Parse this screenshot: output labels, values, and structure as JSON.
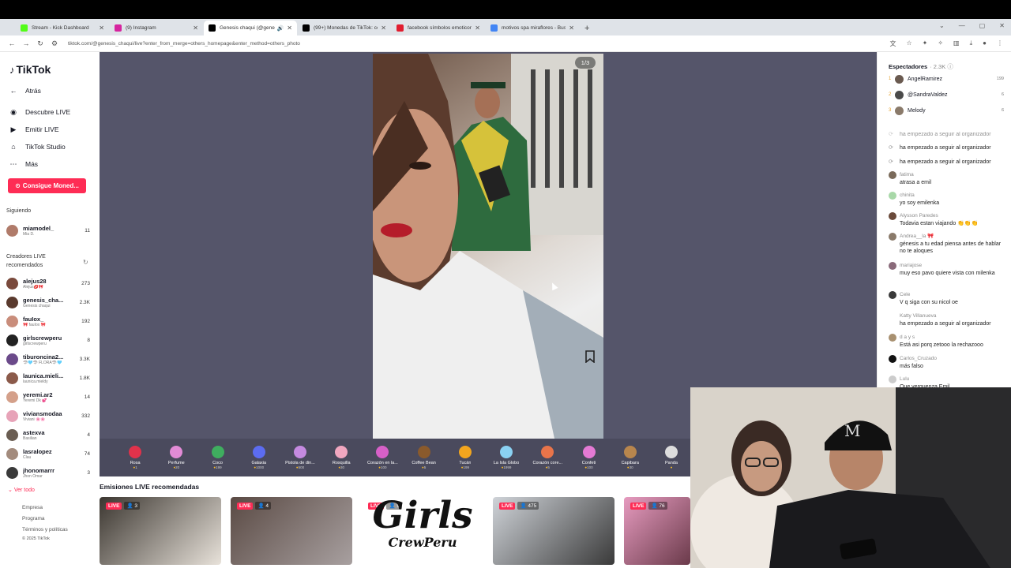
{
  "browser": {
    "tabs": [
      {
        "title": "Stream - Kick Dashboard",
        "color": "#53fc18",
        "active": false
      },
      {
        "title": "(9) Instagram",
        "color": "#d6249f",
        "active": false
      },
      {
        "title": "Genesis chaqui (@genesis_c",
        "color": "#000000",
        "active": true
      },
      {
        "title": "(99+) Monedas de TikTok: comp",
        "color": "#000000",
        "active": false
      },
      {
        "title": "facebook símbolos emoticono",
        "color": "#e11d2f",
        "active": false
      },
      {
        "title": "motivos spa miraflores - Buscar",
        "color": "#4285f4",
        "active": false
      }
    ],
    "url": "tiktok.com/@genesis_chaqui/live?enter_from_merge=others_homepage&enter_method=others_photo"
  },
  "sidebar": {
    "logo": "TikTok",
    "nav": [
      {
        "label": "Atrás",
        "icon": "back-arrow-icon"
      },
      {
        "label": "Descubre LIVE",
        "icon": "live-discover-icon"
      },
      {
        "label": "Emitir LIVE",
        "icon": "broadcast-icon"
      },
      {
        "label": "TikTok Studio",
        "icon": "studio-icon"
      },
      {
        "label": "Más",
        "icon": "more-icon"
      }
    ],
    "coins_button": "Consigue Moned...",
    "following_title": "Siguiendo",
    "following": [
      {
        "name": "miamodel_",
        "sub": "Mia D.",
        "count": "11",
        "color": "#b07b6a"
      }
    ],
    "recommended_title_1": "Creadores LIVE",
    "recommended_title_2": "recomendados",
    "recommended": [
      {
        "name": "alejus28",
        "sub": "Alejus💋🎀",
        "count": "273",
        "color": "#7a4a3c"
      },
      {
        "name": "genesis_cha...",
        "sub": "Genesis chaqui",
        "count": "2.3K",
        "color": "#5a3a2e"
      },
      {
        "name": "fauIox_",
        "sub": "🎀 fauIox 🎀",
        "count": "192",
        "color": "#c98d7b"
      },
      {
        "name": "girlscrewperu",
        "sub": "girlscrewperu",
        "count": "8",
        "color": "#222222"
      },
      {
        "name": "tiburoncina2...",
        "sub": "🦈🩵🦈 FLORA🦈🩵",
        "count": "3.3K",
        "color": "#6b4a8a"
      },
      {
        "name": "launica.mieli...",
        "sub": "launica.mieldy",
        "count": "1.8K",
        "color": "#8b5a4a"
      },
      {
        "name": "yeremi.ar2",
        "sub": "Yeremi Dk 💕",
        "count": "14",
        "color": "#d4a08a"
      },
      {
        "name": "viviansmodaa",
        "sub": "Viviani 🌸🌸",
        "count": "332",
        "color": "#e7a3b8"
      },
      {
        "name": "astexva",
        "sub": "Basilian",
        "count": "4",
        "color": "#6a5d52"
      },
      {
        "name": "lasralopez",
        "sub": "Clau",
        "count": "74",
        "color": "#a38b7d"
      },
      {
        "name": "jhonomarrr",
        "sub": "Jhon Omar",
        "count": "3",
        "color": "#3a3a3a"
      }
    ],
    "see_all": "Ver todo",
    "footer": [
      "Empresa",
      "Programa",
      "Términos y políticas",
      "© 2025 TikTok"
    ]
  },
  "video": {
    "counter": "1/3"
  },
  "gifts": [
    {
      "name": "Rosa",
      "price": "1",
      "color": "#e0324b"
    },
    {
      "name": "Perfume",
      "price": "20",
      "color": "#e28bd6"
    },
    {
      "name": "Coco",
      "price": "199",
      "color": "#3fae5f"
    },
    {
      "name": "Galaxia",
      "price": "1000",
      "color": "#5c6cf0"
    },
    {
      "name": "Pistola de din...",
      "price": "500",
      "color": "#c58ae0"
    },
    {
      "name": "Rosquilla",
      "price": "30",
      "color": "#f1a7c0"
    },
    {
      "name": "Corazón en la...",
      "price": "100",
      "color": "#d760c8"
    },
    {
      "name": "Coffee Bean",
      "price": "5",
      "color": "#8a5a2c"
    },
    {
      "name": "Tucán",
      "price": "199",
      "color": "#f2a51e"
    },
    {
      "name": "La Isla Globo",
      "price": "1999",
      "color": "#8ad1f2"
    },
    {
      "name": "Corazón core...",
      "price": "5",
      "color": "#e8744a"
    },
    {
      "name": "Confeti",
      "price": "100",
      "color": "#e47ad4"
    },
    {
      "name": "Capibara",
      "price": "30",
      "color": "#b8864d"
    },
    {
      "name": "Panda",
      "price": "",
      "color": "#dddddd"
    }
  ],
  "recommended_live": {
    "title": "Emisiones LIVE recomendadas",
    "live_label": "LIVE",
    "items": [
      {
        "viewers": "3",
        "colors": [
          "#3b3630",
          "#e8e2da"
        ]
      },
      {
        "viewers": "4",
        "colors": [
          "#5a4a44",
          "#a8a0a0"
        ]
      },
      {
        "viewers": "9",
        "colors": [
          "#ffffff",
          "#ffffff"
        ]
      },
      {
        "viewers": "475",
        "colors": [
          "#cfd3d8",
          "#3a3a3a"
        ]
      },
      {
        "viewers": "76",
        "colors": [
          "#e69bbf",
          "#6a3a4a"
        ]
      }
    ],
    "girls_line1": "Girls",
    "girls_line2": "CrewPeru"
  },
  "viewers_panel": {
    "title": "Espectadores",
    "count": "2.3K",
    "top": [
      {
        "rank": "1",
        "name": "AngelRamirez",
        "score": "199",
        "color": "#6a5a50"
      },
      {
        "rank": "2",
        "name": "@SandraValdez",
        "score": "6",
        "color": "#4a4a4a"
      },
      {
        "rank": "3",
        "name": "Melody",
        "score": "6",
        "color": "#8a7a6a"
      }
    ]
  },
  "chat": [
    {
      "user": "",
      "msg": "ha empezado a seguir al organizador",
      "color": "#ffffff",
      "sys": true,
      "faded": true
    },
    {
      "user": "",
      "msg": "ha empezado a seguir al organizador",
      "color": "#dddddd",
      "sys": true
    },
    {
      "user": "",
      "msg": "ha empezado a seguir al organizador",
      "color": "#dddddd",
      "sys": true
    },
    {
      "user": "fatima",
      "msg": "atrasa a emil",
      "color": "#7a6a5a"
    },
    {
      "user": "chinita",
      "msg": "yo soy emilenka",
      "color": "#a8d8a8"
    },
    {
      "user": "Alysson Paredes",
      "msg": "Todavia estan viajando 👏👏👏",
      "color": "#6a4a3a"
    },
    {
      "user": "Andrea__la 🎀",
      "msg": "génesis a tu edad piensa antes de hablar no te aloques",
      "color": "#8a7a6a"
    },
    {
      "user": "mariajose",
      "msg": "muy eso pavo quiere vista con milenka",
      "color": "#8a6a7a"
    },
    {
      "user": "Cele",
      "msg": "V q siga con su nicol oe",
      "color": "#3a3a3a"
    },
    {
      "user": "Katty Villanueva",
      "msg": "ha empezado a seguir al organizador",
      "color": "#ffffff"
    },
    {
      "user": "d a y s",
      "msg": "Está asi porq zetooo la rechazooo",
      "color": "#a89070"
    },
    {
      "user": "Carlos_Cruzado",
      "msg": "más falso",
      "color": "#111111"
    },
    {
      "user": "Lulu",
      "msg": "Que verguenza Emil",
      "color": "#cccccc"
    }
  ]
}
